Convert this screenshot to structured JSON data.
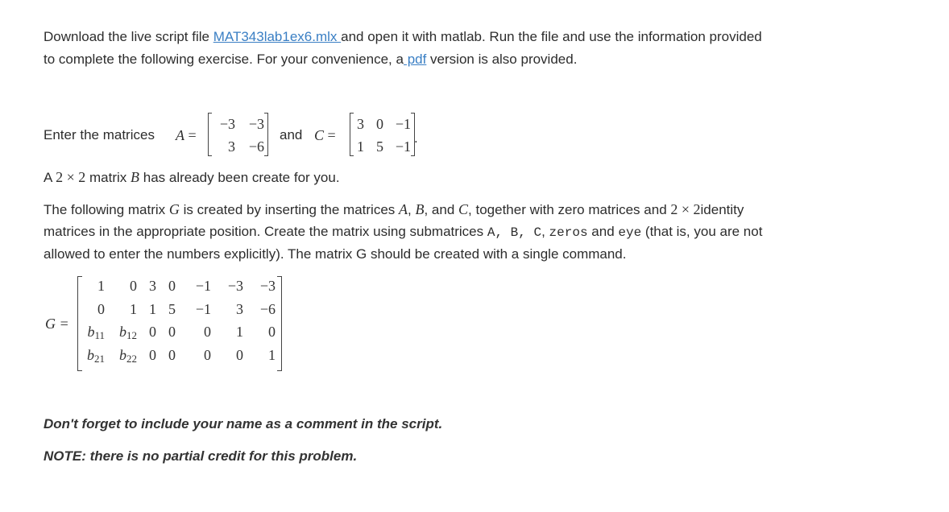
{
  "intro": {
    "line1_prefix": "Download the live script file ",
    "file_link": "MAT343lab1ex6.mlx ",
    "line1_suffix": " and open it with matlab. Run the file and use the information provided",
    "line2_prefix": "to complete the following exercise. For your convenience, a",
    "pdf_link": " pdf",
    "line2_suffix": " version is also provided."
  },
  "enter": {
    "prefix": "Enter the matrices ",
    "A_label": "A",
    "equals": "=",
    "and": "and",
    "C_label": "C",
    "period": "."
  },
  "matrix_A": [
    [
      "−3",
      "−3"
    ],
    [
      "3",
      "−6"
    ]
  ],
  "matrix_C": [
    [
      "3",
      "0",
      "−1"
    ],
    [
      "1",
      "5",
      "−1"
    ]
  ],
  "b_statement": {
    "prefix": "A ",
    "dims": "2 × 2",
    "middle": " matrix ",
    "B_label": "B",
    "suffix": " has already been create for you."
  },
  "description": {
    "line1_a": "The following matrix ",
    "G": "G",
    "line1_b": " is created by inserting the matrices ",
    "A": "A",
    "comma1": ", ",
    "B": "B",
    "comma2": ", and ",
    "C": "C",
    "line1_c": ", together with zero matrices and ",
    "dims": "2 × 2",
    "line1_d": "identity",
    "line2_a": "matrices in the appropriate position. Create the matrix using submatrices ",
    "code_abc": "A, B, C",
    "line2_b": ", ",
    "code_zeros": "zeros",
    "line2_c": " and ",
    "code_eye": "eye",
    "line2_d": " (that is, you are not",
    "line3": "allowed to enter the numbers explicitly). The matrix G should be created with a single command."
  },
  "matrix_G": {
    "label": "G =",
    "rows": [
      [
        "1",
        "0",
        "3",
        "0",
        "−1",
        "−3",
        "−3"
      ],
      [
        "0",
        "1",
        "1",
        "5",
        "−1",
        "3",
        "−6"
      ],
      [
        "b11",
        "b12",
        "0",
        "0",
        "0",
        "1",
        "0"
      ],
      [
        "b21",
        "b22",
        "0",
        "0",
        "0",
        "0",
        "1"
      ]
    ]
  },
  "notes": {
    "reminder": "Don't forget to include your name as a comment in the script.",
    "no_partial": "NOTE: there is no partial credit for this problem."
  }
}
